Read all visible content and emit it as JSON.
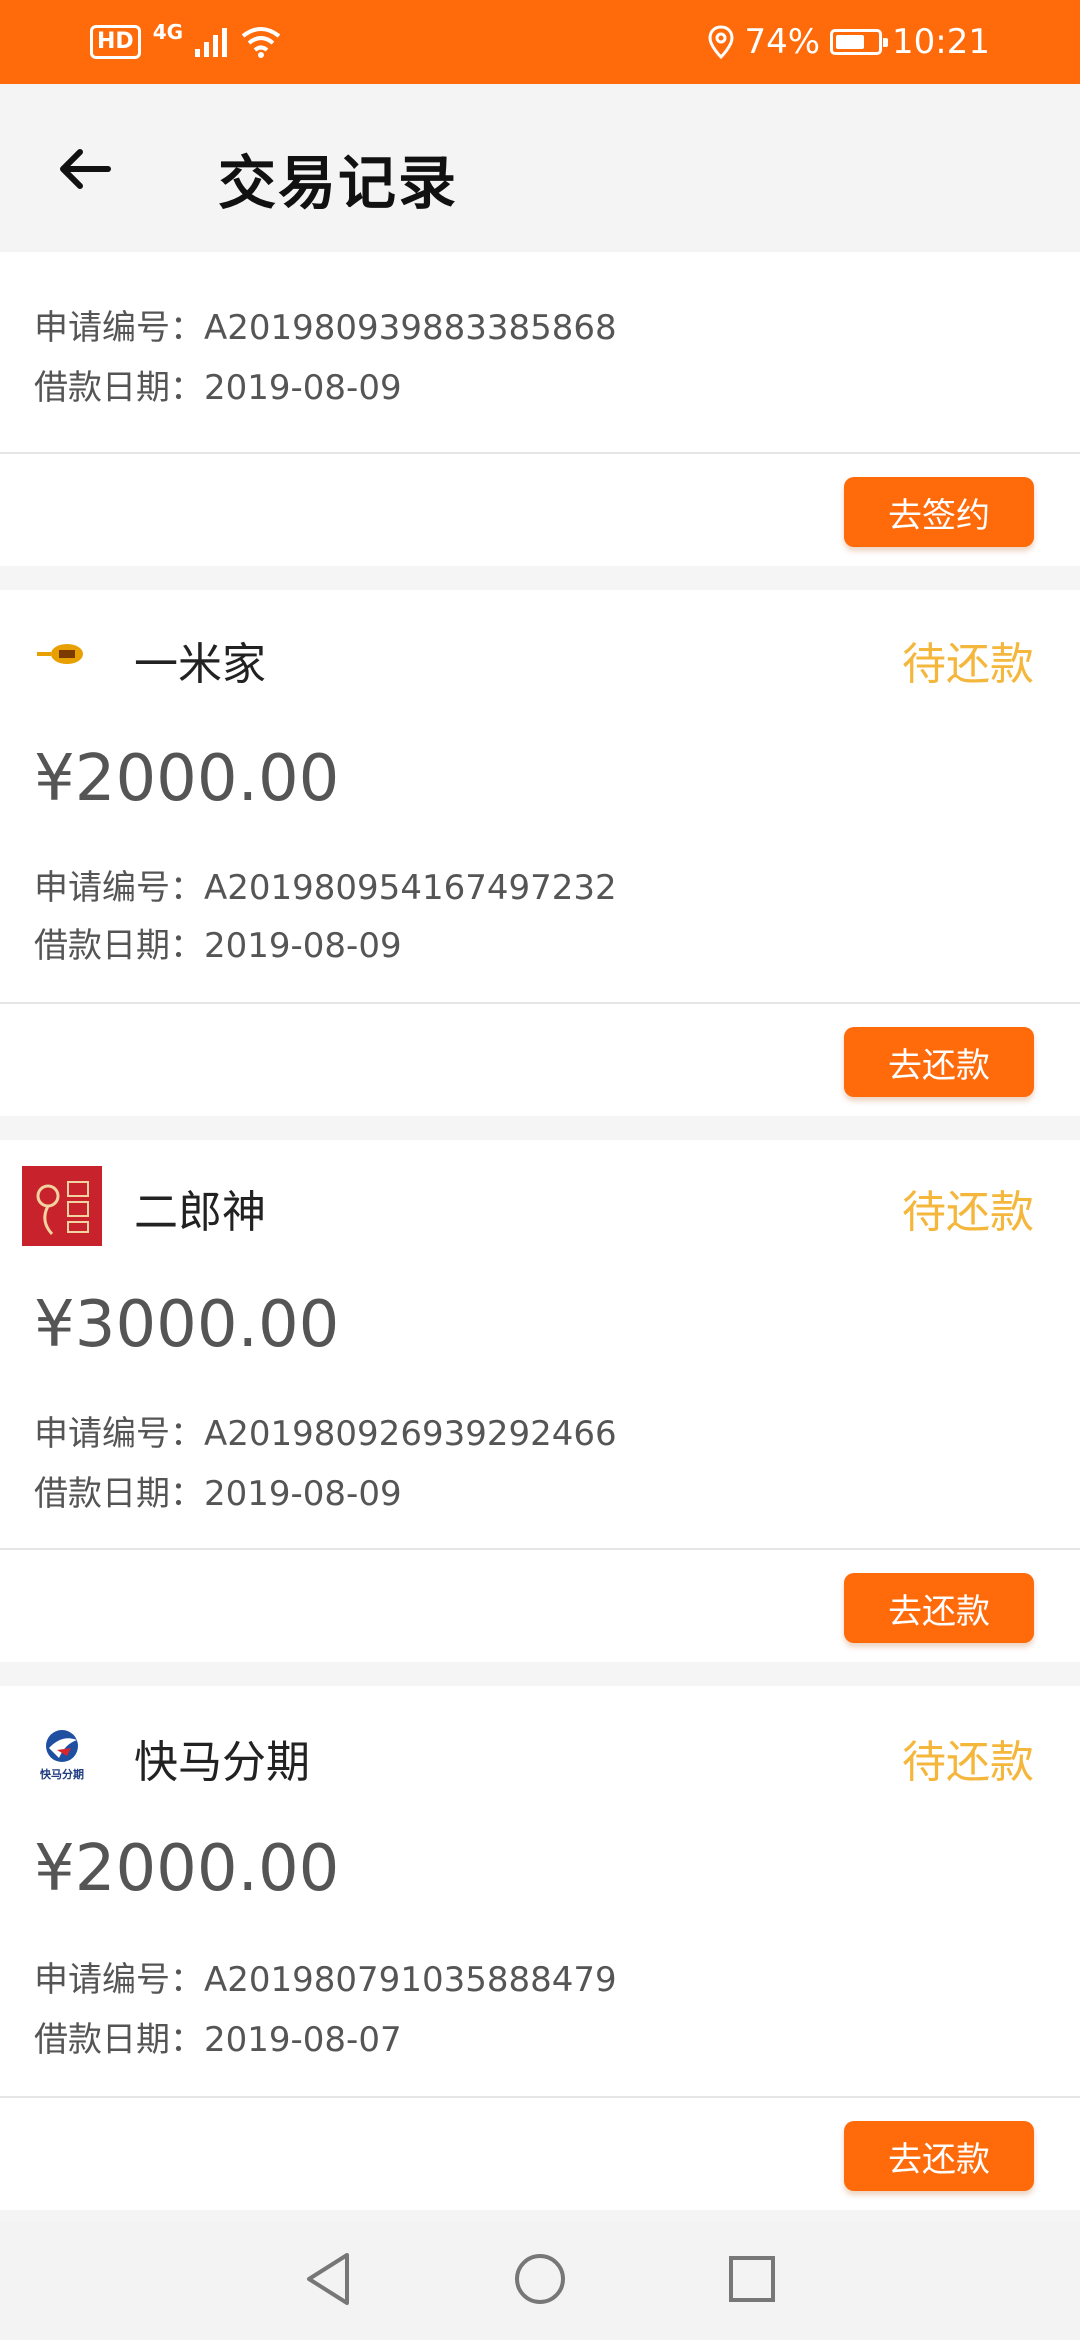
{
  "status_bar": {
    "hd": "HD",
    "network": "4G",
    "battery_level": "74%",
    "time": "10:21",
    "battery_fraction": 0.74
  },
  "header": {
    "title": "交易记录"
  },
  "labels": {
    "apply_no": "申请编号：",
    "loan_date": "借款日期："
  },
  "records": [
    {
      "apply_no": "A201980939883385868",
      "loan_date": "2019-08-09",
      "action": "去签约"
    },
    {
      "company": "一米家",
      "status": "待还款",
      "amount": "¥2000.00",
      "apply_no": "A201980954167497232",
      "loan_date": "2019-08-09",
      "action": "去还款"
    },
    {
      "company": "二郎神",
      "status": "待还款",
      "amount": "¥3000.00",
      "apply_no": "A201980926939292466",
      "loan_date": "2019-08-09",
      "action": "去还款"
    },
    {
      "company": "快马分期",
      "status": "待还款",
      "amount": "¥2000.00",
      "apply_no": "A201980791035888479",
      "loan_date": "2019-08-07",
      "action": "去还款",
      "logo_text": "快马分期"
    }
  ],
  "colors": {
    "brand": "#ff6a0a",
    "status_pending": "#f5b63c"
  },
  "icons": {
    "back": "back-arrow-icon",
    "nav_back": "nav-back-icon",
    "nav_home": "nav-home-icon",
    "nav_recent": "nav-recent-icon"
  }
}
